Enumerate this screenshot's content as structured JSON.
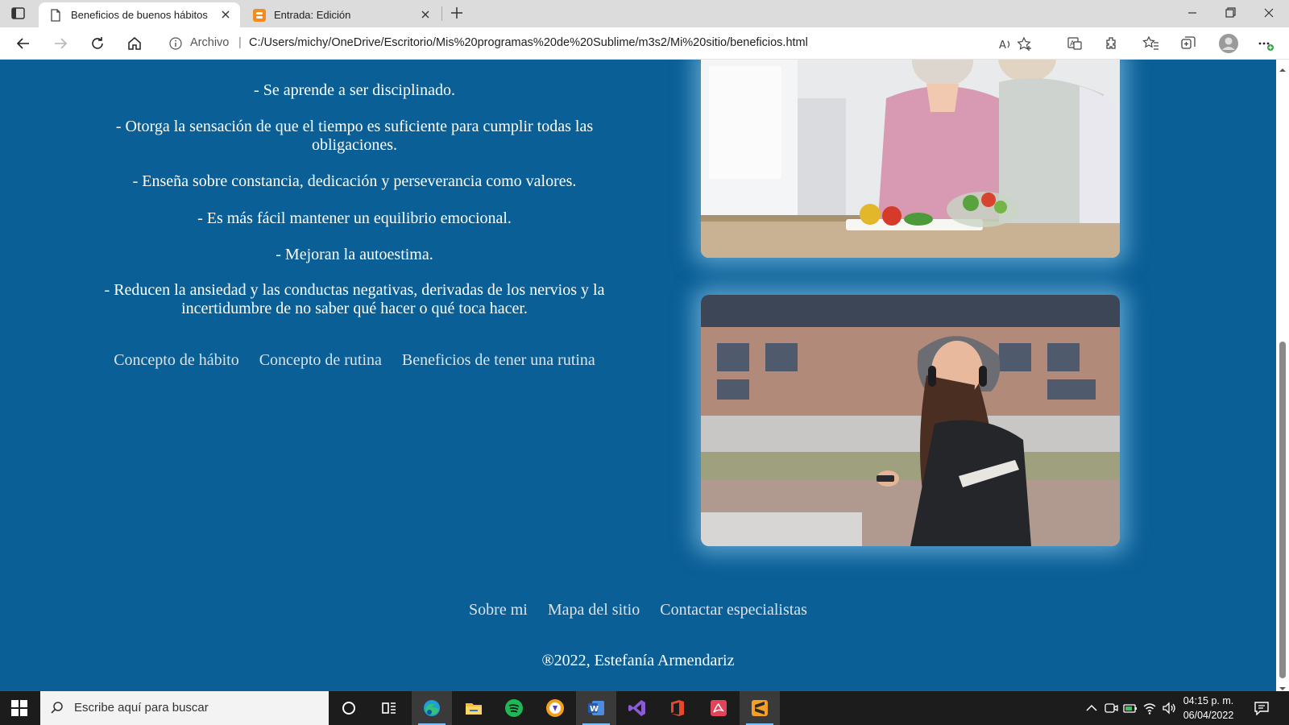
{
  "browser": {
    "tabs": [
      {
        "title": "Beneficios de buenos hábitos",
        "active": true
      },
      {
        "title": "Entrada: Edición",
        "active": false
      }
    ],
    "address": {
      "label": "Archivo",
      "separator": "|",
      "url": "C:/Users/michy/OneDrive/Escritorio/Mis%20programas%20de%20Sublime/m3s2/Mi%20sitio/beneficios.html"
    }
  },
  "page": {
    "benefits": [
      "- Se aprende a ser disciplinado.",
      "- Otorga la sensación de que el tiempo es suficiente para cumplir todas las obligaciones.",
      "- Enseña sobre constancia, dedicación y perseverancia como valores.",
      "- Es más fácil mantener un equilibrio emocional.",
      "- Mejoran la autoestima.",
      "- Reducen la ansiedad y las conductas negativas, derivadas de los nervios y la incertidumbre de no saber qué hacer o qué toca hacer."
    ],
    "nav_links": [
      "Concepto de hábito",
      "Concepto de rutina",
      "Beneficios de tener una rutina"
    ],
    "footer_links": [
      "Sobre mi",
      "Mapa del sitio",
      "Contactar especialistas"
    ],
    "copyright": "®2022, Estefanía Armendariz"
  },
  "taskbar": {
    "search_placeholder": "Escribe aquí para buscar",
    "time": "04:15 p. m.",
    "date": "06/04/2022"
  },
  "colors": {
    "page_background": "#0a5f96",
    "link_color": "#d8e4ee",
    "text_color": "#ffffff"
  }
}
